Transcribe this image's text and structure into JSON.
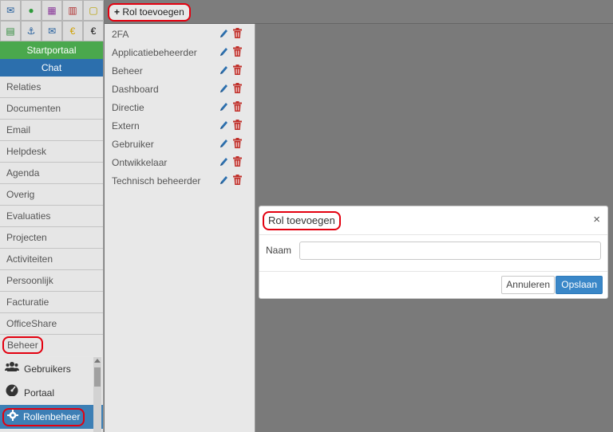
{
  "toolbar": {
    "add_role_label": "Rol toevoegen"
  },
  "sidebar": {
    "icons": [
      {
        "name": "mail-icon",
        "glyph": "✉",
        "color": "#1e5a9a"
      },
      {
        "name": "chat-icon",
        "glyph": "●",
        "color": "#2e9a3a"
      },
      {
        "name": "calendar-icon",
        "glyph": "▦",
        "color": "#8a3a9a"
      },
      {
        "name": "building-icon",
        "glyph": "▥",
        "color": "#b03030"
      },
      {
        "name": "note-icon",
        "glyph": "▢",
        "color": "#b8a000"
      },
      {
        "name": "spreadsheet-icon",
        "glyph": "▤",
        "color": "#2e8a3a"
      },
      {
        "name": "anchor-icon",
        "glyph": "⚓",
        "color": "#1e5a9a"
      },
      {
        "name": "envelope-icon",
        "glyph": "✉",
        "color": "#1e5a9a"
      },
      {
        "name": "euro-yellow-icon",
        "glyph": "€",
        "color": "#d0a000"
      },
      {
        "name": "euro-black-icon",
        "glyph": "€",
        "color": "#111111"
      }
    ],
    "start_label": "Startportaal",
    "chat_label": "Chat",
    "items": [
      "Relaties",
      "Documenten",
      "Email",
      "Helpdesk",
      "Agenda",
      "Overig",
      "Evaluaties",
      "Projecten",
      "Activiteiten",
      "Persoonlijk",
      "Facturatie",
      "OfficeShare",
      "Beheer"
    ],
    "submenu": [
      {
        "label": "Gebruikers",
        "icon": "users-icon"
      },
      {
        "label": "Portaal",
        "icon": "dashboard-icon"
      },
      {
        "label": "Rollenbeheer",
        "icon": "gear-icon"
      }
    ]
  },
  "roles": [
    "2FA",
    "Applicatiebeheerder",
    "Beheer",
    "Dashboard",
    "Directie",
    "Extern",
    "Gebruiker",
    "Ontwikkelaar",
    "Technisch beheerder"
  ],
  "modal": {
    "title": "Rol toevoegen",
    "close": "×",
    "field_label": "Naam",
    "field_value": "",
    "cancel_label": "Annuleren",
    "save_label": "Opslaan"
  },
  "colors": {
    "highlight": "#e3000f",
    "start": "#4aa84d",
    "chat": "#2c6fad",
    "active_submenu": "#3d7fb5",
    "save": "#3a87c8"
  }
}
